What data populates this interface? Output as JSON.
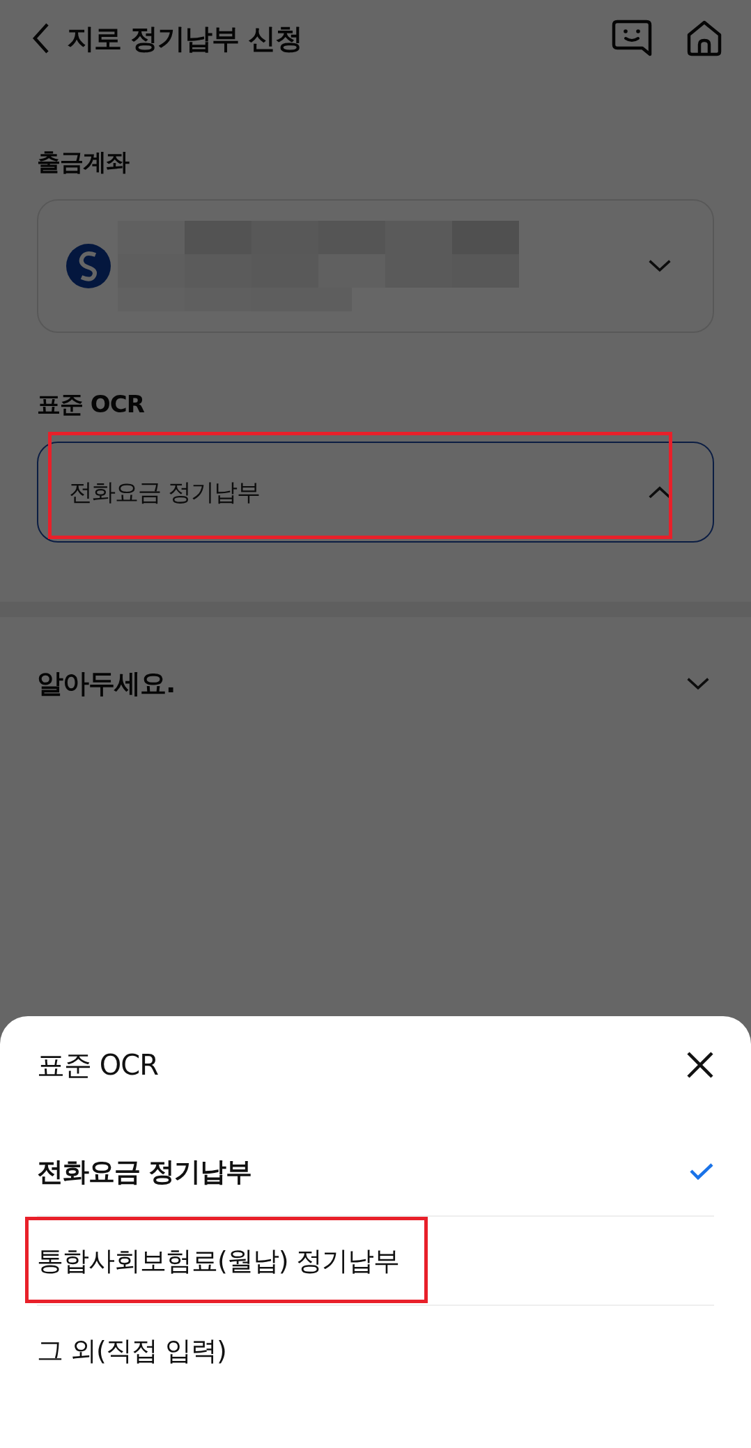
{
  "header": {
    "title": "지로 정기납부 신청"
  },
  "account": {
    "label": "출금계좌"
  },
  "ocr": {
    "label": "표준 OCR",
    "value": "전화요금 정기납부",
    "expanded": true,
    "highlighted": true
  },
  "notice": {
    "title": "알아두세요.",
    "expanded": false
  },
  "sheet": {
    "title": "표준 OCR",
    "options": [
      {
        "label": "전화요금 정기납부",
        "selected": true,
        "highlighted": false
      },
      {
        "label": "통합사회보험료(월납) 정기납부",
        "selected": false,
        "highlighted": true
      },
      {
        "label": "그 외(직접 입력)",
        "selected": false,
        "highlighted": false
      }
    ]
  }
}
